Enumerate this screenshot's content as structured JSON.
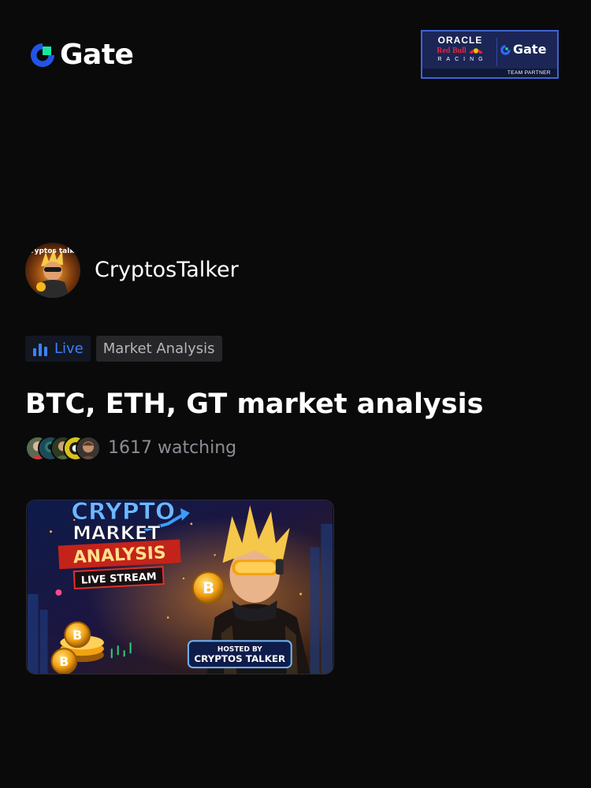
{
  "brand": {
    "name": "Gate",
    "logo_icon": "gate-logo-icon"
  },
  "partner_badge": {
    "oracle": "ORACLE",
    "red_bull": "Red Bull",
    "racing": "RACING",
    "gate": "Gate",
    "footer": "TEAM PARTNER",
    "colors": {
      "background": "#1b2656",
      "border": "#3f63d4",
      "red": "#e8253a"
    }
  },
  "host": {
    "name": "CryptosTalker",
    "avatar_text": "cryptos talke"
  },
  "tags": {
    "live": "Live",
    "live_icon": "bar-chart-icon",
    "category": "Market Analysis"
  },
  "stream": {
    "title": "BTC, ETH, GT market analysis",
    "viewers": "1617 watching"
  },
  "thumbnail": {
    "line1": "CRYPTO",
    "line2": "MARKET",
    "line3": "ANALYSIS",
    "line4": "LIVE STREAM",
    "hosted_by": "HOSTED BY",
    "host": "CRYPTOS TALKER"
  },
  "colors": {
    "background": "#0a0a0b",
    "accent_blue": "#3b82f6",
    "tag_background": "#262629",
    "muted_text": "#8b8d93"
  }
}
